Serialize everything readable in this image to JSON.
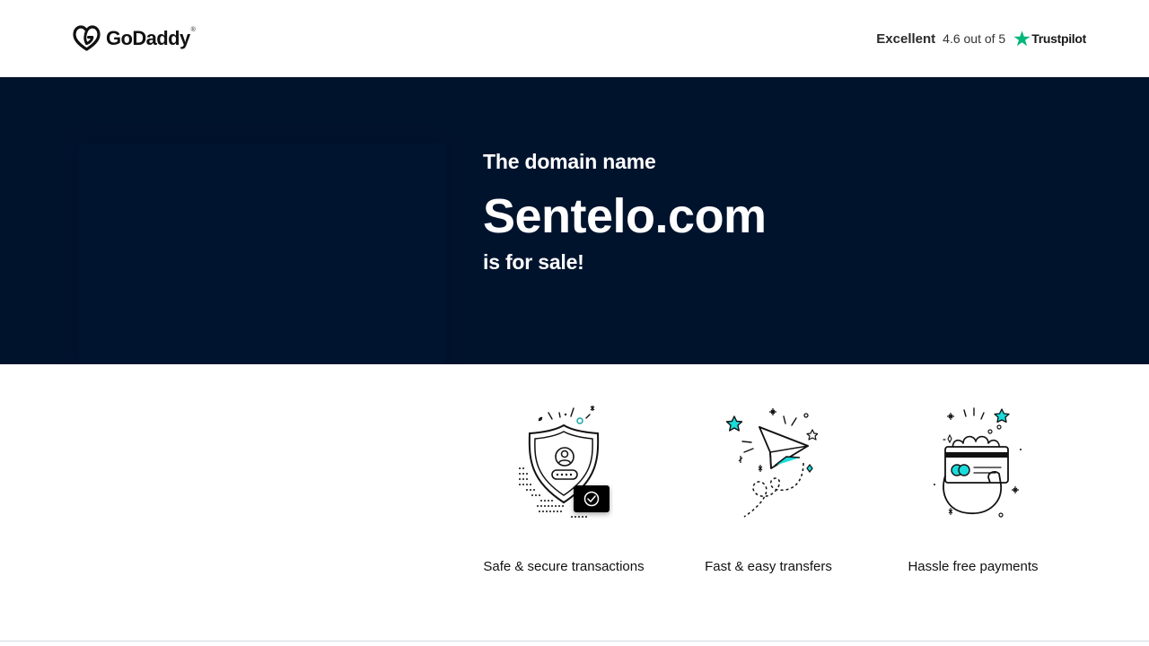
{
  "header": {
    "logo_text": "GoDaddy",
    "logo_mark": "®",
    "rating_label": "Excellent",
    "rating_score": "4.6 out of 5",
    "review_site": "Trustpilot"
  },
  "hero": {
    "pre_text": "The domain name",
    "domain": "Sentelo.com",
    "post_text": "is for sale!"
  },
  "features": [
    {
      "icon": "shield-check-icon",
      "caption": "Safe & secure transactions"
    },
    {
      "icon": "paper-plane-icon",
      "caption": "Fast & easy transfers"
    },
    {
      "icon": "hand-card-icon",
      "caption": "Hassle free payments"
    }
  ],
  "colors": {
    "hero_background": "#00132d",
    "trustpilot_green": "#00b67a",
    "accent_teal": "#1bdbdb",
    "text_dark": "#111111"
  }
}
